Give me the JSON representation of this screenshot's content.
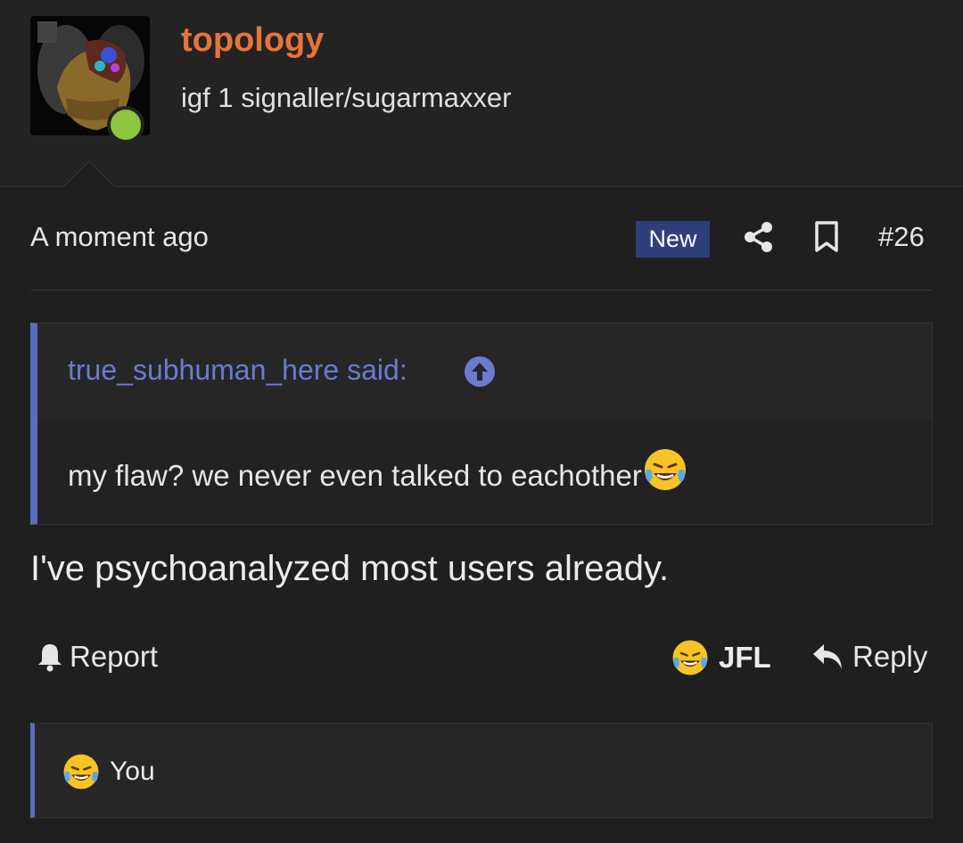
{
  "user": {
    "username": "topology",
    "title": "igf 1 signaller/sugarmaxxer",
    "online": true,
    "avatar_icon": "avatar-image"
  },
  "post": {
    "timestamp": "A moment ago",
    "badge": "New",
    "number": "#26",
    "share_icon": "share-icon",
    "bookmark_icon": "bookmark-icon",
    "body": "I've psychoanalyzed most users already."
  },
  "quote": {
    "author": "true_subhuman_here said:",
    "text": "my flaw? we never even talked to eachother",
    "jump_icon": "arrow-up-circle-icon"
  },
  "actions": {
    "report_label": "Report",
    "react_label": "JFL",
    "reply_label": "Reply"
  },
  "reactions": {
    "summary": "You",
    "emoji": "laughing-crying-emoji"
  },
  "colors": {
    "accent": "#5c6bc0",
    "username": "#e8743b",
    "online": "#8dc63f",
    "badge_bg": "#2f3f7a"
  }
}
